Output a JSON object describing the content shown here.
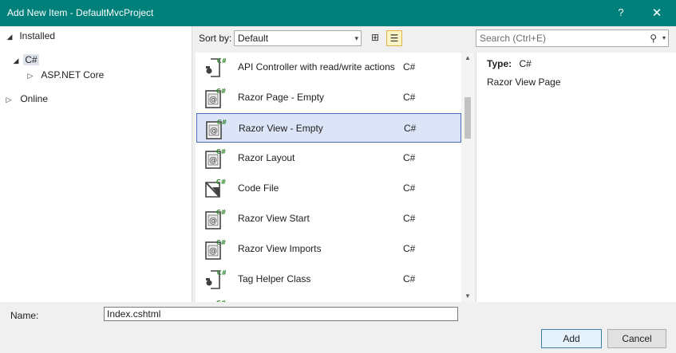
{
  "window": {
    "title": "Add New Item - DefaultMvcProject",
    "help_glyph": "?",
    "close_glyph": "✕"
  },
  "tree": {
    "installed": {
      "arrow": "◢",
      "label": "Installed"
    },
    "csharp": {
      "arrow": "◢",
      "label": "C#"
    },
    "aspnet": {
      "arrow": "▷",
      "label": "ASP.NET Core"
    },
    "online": {
      "arrow": "▷",
      "label": "Online"
    }
  },
  "sort": {
    "label": "Sort by:",
    "value": "Default",
    "caret": "▾"
  },
  "view_icons": {
    "grid": "⊞",
    "list": "☰"
  },
  "search": {
    "placeholder": "Search (Ctrl+E)",
    "icon": "⚲",
    "caret": "▾"
  },
  "items": [
    {
      "name": "API Controller with read/write actions",
      "lang": "C#",
      "icon": "controller-icon"
    },
    {
      "name": "Razor Page - Empty",
      "lang": "C#",
      "icon": "razor-icon"
    },
    {
      "name": "Razor View - Empty",
      "lang": "C#",
      "icon": "razor-icon",
      "selected": true
    },
    {
      "name": "Razor Layout",
      "lang": "C#",
      "icon": "razor-icon"
    },
    {
      "name": "Code File",
      "lang": "C#",
      "icon": "code-file-icon"
    },
    {
      "name": "Razor View Start",
      "lang": "C#",
      "icon": "razor-icon"
    },
    {
      "name": "Razor View Imports",
      "lang": "C#",
      "icon": "razor-icon"
    },
    {
      "name": "Tag Helper Class",
      "lang": "C#",
      "icon": "controller-icon"
    }
  ],
  "details": {
    "type_label": "Type:",
    "type_value": "C#",
    "description": "Razor View Page"
  },
  "name_field": {
    "label": "Name:",
    "value": "Index.cshtml"
  },
  "buttons": {
    "add": "Add",
    "cancel": "Cancel"
  },
  "scroll": {
    "up": "▲",
    "down": "▼"
  },
  "colors": {
    "titlebar": "#00807a",
    "selection_border": "#4b6db3",
    "selection_bg": "#dce4f7",
    "csharp_badge": "#388a34"
  }
}
